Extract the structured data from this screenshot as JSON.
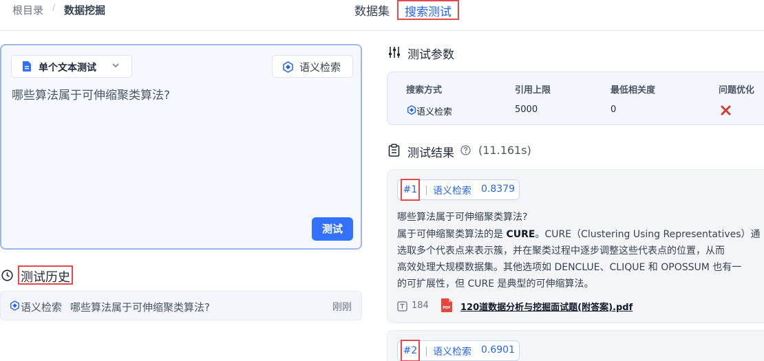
{
  "breadcrumb": {
    "root": "根目录",
    "separator": "/",
    "current": "数据挖掘"
  },
  "tabs": {
    "dataset": "数据集",
    "search_test": "搜索测试"
  },
  "test_panel": {
    "mode_label": "单个文本测试",
    "semantic_button": "语义检索",
    "query": "哪些算法属于可伸缩聚类算法?",
    "run_button": "测试"
  },
  "history": {
    "title": "测试历史",
    "items": [
      {
        "mode": "语义检索",
        "query": "哪些算法属于可伸缩聚类算法?",
        "time": "刚刚"
      }
    ]
  },
  "params": {
    "title": "测试参数",
    "headers": [
      "搜索方式",
      "引用上限",
      "最低相关度",
      "问题优化"
    ],
    "values": {
      "mode": "语义检索",
      "limit": "5000",
      "min_relevance": "0",
      "optimize": "✖"
    }
  },
  "results": {
    "title": "测试结果",
    "time": "(11.161s)",
    "items": [
      {
        "rank": "#1",
        "mode": "语义检索",
        "score": "0.8379",
        "line1": "哪些算法属于可伸缩聚类算法?",
        "line2_prefix": "属于可伸缩聚类算法的是 ",
        "line2_bold": "CURE",
        "line2_suffix": "。CURE（Clustering Using Representatives）通",
        "line3": "选取多个代表点来表示簇，并在聚类过程中逐步调整这些代表点的位置，从而",
        "line4": "高效处理大规模数据集。其他选项如 DENCLUE、CLIQUE 和 OPOSSUM 也有一",
        "line5": "的可扩展性，但 CURE 是典型的可伸缩算法。",
        "chunk_count": "184",
        "source_file": "120道数据分析与挖掘面试题(附答案).pdf"
      },
      {
        "rank": "#2",
        "mode": "语义检索",
        "score": "0.6901"
      }
    ]
  },
  "colors": {
    "accent": "#3371ff",
    "highlight_box": "#e5484d",
    "danger": "#d63b2f"
  }
}
